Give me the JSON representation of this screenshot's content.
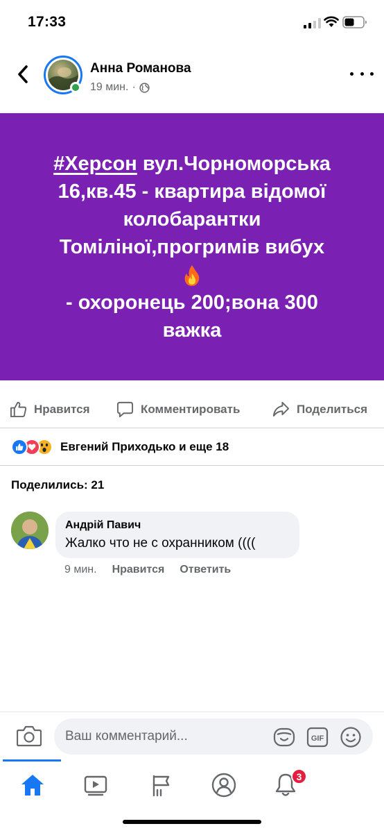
{
  "status_bar": {
    "time": "17:33"
  },
  "post": {
    "author": "Анна Романова",
    "time": "19 мин.",
    "meta_separator": "·",
    "text_lines": {
      "hashtag": "#Херсон",
      "line1_rest": " вул.Чорноморська",
      "line2": "16,кв.45 - квартира відомої",
      "line3": "колобарантки",
      "line4": "Томіліної,прогримів вибух",
      "line6": "- охоронець 200;вона 300",
      "line7": "важка"
    },
    "background_color": "#7a21b3"
  },
  "actions": {
    "like_label": "Нравится",
    "comment_label": "Комментировать",
    "share_label": "Поделиться"
  },
  "reactions": {
    "summary": "Евгений Приходько и еще 18",
    "icons": [
      "like-icon",
      "love-icon",
      "wow-icon"
    ]
  },
  "shares": {
    "label": "Поделились: 21"
  },
  "comment": {
    "author": "Андрій Павич",
    "text": "Жалко что не с охранником ((((",
    "time": "9 мин.",
    "like_label": "Нравится",
    "reply_label": "Ответить"
  },
  "composer": {
    "placeholder": "Ваш комментарий..."
  },
  "tab_bar": {
    "tabs": [
      "home-icon",
      "watch-icon",
      "pages-icon",
      "profile-icon",
      "notifications-icon"
    ],
    "notifications_badge": "3"
  },
  "colors": {
    "accent": "#1877f2",
    "secondary_text": "#65676b",
    "badge": "#e41e3f",
    "online": "#31a24c"
  }
}
